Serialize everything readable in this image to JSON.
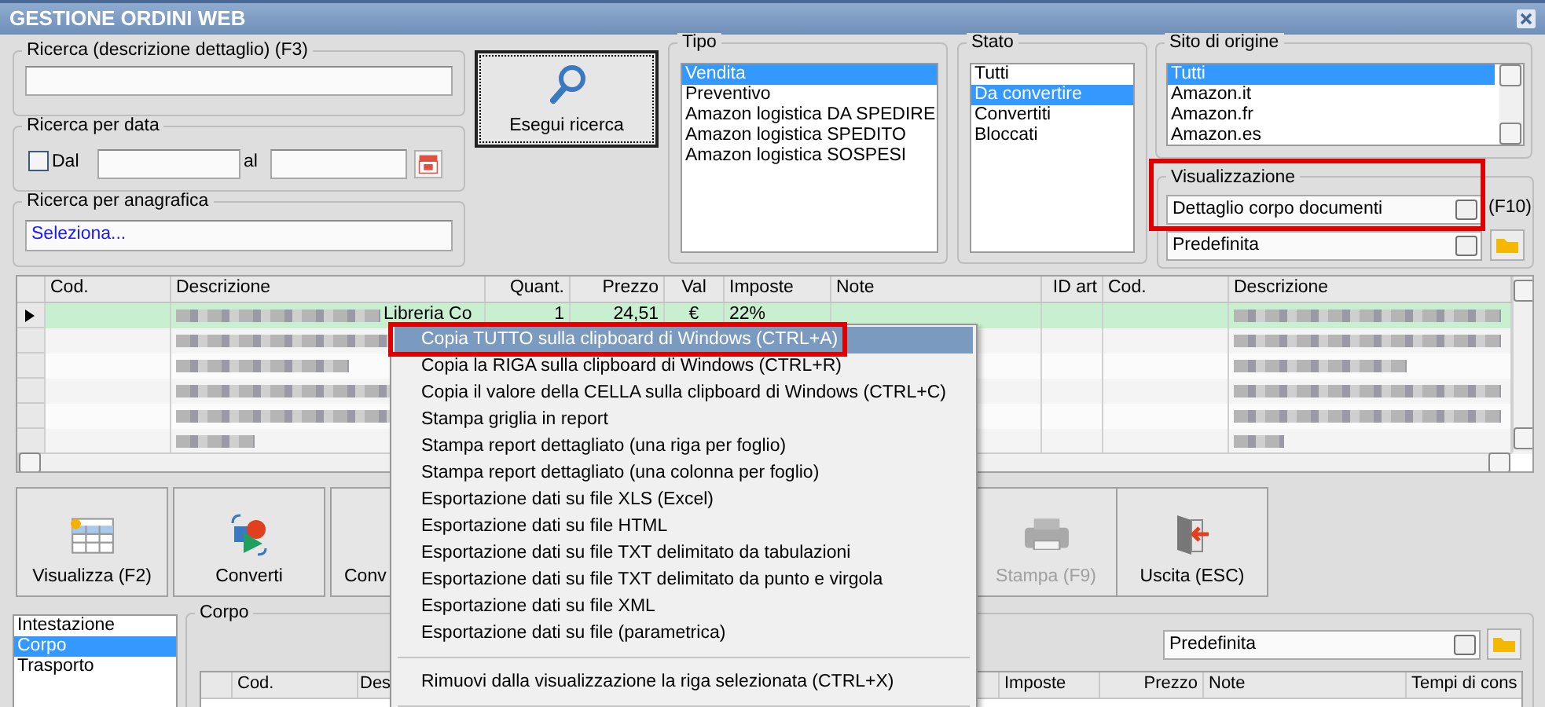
{
  "window": {
    "title": "GESTIONE ORDINI WEB"
  },
  "search_description": {
    "label": "Ricerca (descrizione dettaglio) (F3)"
  },
  "search_date": {
    "label": "Ricerca per data",
    "checkbox_label": "Dal",
    "checked": false,
    "to_label": "al"
  },
  "search_registry": {
    "label": "Ricerca per anagrafica",
    "value": "Seleziona..."
  },
  "search_button": {
    "label": "Esegui ricerca"
  },
  "tipo": {
    "label": "Tipo",
    "items": [
      {
        "label": "Vendita",
        "selected": true
      },
      {
        "label": "Preventivo",
        "selected": false
      },
      {
        "label": "Amazon logistica DA SPEDIRE",
        "selected": false
      },
      {
        "label": "Amazon logistica SPEDITO",
        "selected": false
      },
      {
        "label": "Amazon logistica SOSPESI",
        "selected": false
      }
    ]
  },
  "stato": {
    "label": "Stato",
    "items": [
      {
        "label": "Tutti",
        "selected": false
      },
      {
        "label": "Da convertire",
        "selected": true
      },
      {
        "label": "Convertiti",
        "selected": false
      },
      {
        "label": "Bloccati",
        "selected": false
      }
    ]
  },
  "sito": {
    "label": "Sito di origine",
    "items": [
      {
        "label": "Tutti",
        "selected": true
      },
      {
        "label": "Amazon.it",
        "selected": false
      },
      {
        "label": "Amazon.fr",
        "selected": false
      },
      {
        "label": "Amazon.es",
        "selected": false
      }
    ]
  },
  "visualizzazione": {
    "label": "Visualizzazione",
    "view": "Dettaglio corpo documenti",
    "shortcut": "(F10)",
    "layout": "Predefinita"
  },
  "grid": {
    "columns": [
      "Cod.",
      "Descrizione",
      "Quant.",
      "Prezzo",
      "Val",
      "Imposte",
      "Note",
      "ID art",
      "Cod.",
      "Descrizione"
    ],
    "rows": [
      {
        "selected": true,
        "redacted": true,
        "cells": [
          "",
          "Libreria Co",
          "1",
          "24,51",
          "€",
          "22%",
          "",
          "",
          "",
          ""
        ]
      },
      {
        "selected": false,
        "redacted": true,
        "cells": [
          "",
          "",
          "",
          "",
          "",
          "",
          "",
          "",
          "",
          ""
        ]
      },
      {
        "selected": false,
        "redacted": true,
        "cells": [
          "",
          "",
          "",
          "",
          "",
          "",
          "",
          "",
          "",
          ""
        ]
      },
      {
        "selected": false,
        "redacted": true,
        "cells": [
          "",
          "",
          "",
          "",
          "",
          "",
          "",
          "",
          "",
          ""
        ]
      },
      {
        "selected": false,
        "redacted": true,
        "cells": [
          "",
          "",
          "",
          "",
          "",
          "",
          "",
          "",
          "",
          ""
        ]
      },
      {
        "selected": false,
        "redacted": true,
        "cells": [
          "",
          "",
          "",
          "",
          "",
          "",
          "",
          "",
          "",
          ""
        ]
      }
    ]
  },
  "buttons": [
    {
      "label": "Visualizza (F2)",
      "disabled": false
    },
    {
      "label": "Converti",
      "disabled": false
    },
    {
      "label": "Conv",
      "disabled": false
    },
    {
      "label": "Stampa (F9)",
      "disabled": true
    },
    {
      "label": "Uscita (ESC)",
      "disabled": false
    }
  ],
  "sections": {
    "items": [
      {
        "label": "Intestazione",
        "selected": false
      },
      {
        "label": "Corpo",
        "selected": true
      },
      {
        "label": "Trasporto",
        "selected": false
      }
    ]
  },
  "corpo": {
    "label": "Corpo",
    "layout": "Predefinita",
    "columns": [
      "Cod.",
      "Des",
      "Imposte",
      "Prezzo",
      "Note",
      "Tempi di cons"
    ]
  },
  "context_menu": {
    "items": [
      {
        "kind": "item",
        "label": "Copia TUTTO sulla clipboard di Windows (CTRL+A)",
        "selected": true
      },
      {
        "kind": "item",
        "label": "Copia la RIGA sulla clipboard di Windows (CTRL+R)",
        "selected": false
      },
      {
        "kind": "item",
        "label": "Copia il valore della CELLA sulla clipboard di Windows (CTRL+C)",
        "selected": false
      },
      {
        "kind": "item",
        "label": "Stampa griglia in report",
        "selected": false
      },
      {
        "kind": "item",
        "label": "Stampa report dettagliato (una riga per foglio)",
        "selected": false
      },
      {
        "kind": "item",
        "label": "Stampa report dettagliato (una colonna per foglio)",
        "selected": false
      },
      {
        "kind": "item",
        "label": "Esportazione dati su file XLS (Excel)",
        "selected": false
      },
      {
        "kind": "item",
        "label": "Esportazione dati su file HTML",
        "selected": false
      },
      {
        "kind": "item",
        "label": "Esportazione dati su file TXT delimitato da tabulazioni",
        "selected": false
      },
      {
        "kind": "item",
        "label": "Esportazione dati su file TXT delimitato da punto e virgola",
        "selected": false
      },
      {
        "kind": "item",
        "label": "Esportazione dati su file XML",
        "selected": false
      },
      {
        "kind": "item",
        "label": "Esportazione dati su file (parametrica)",
        "selected": false
      },
      {
        "kind": "separator"
      },
      {
        "kind": "item",
        "label": "Rimuovi dalla visualizzazione la riga selezionata (CTRL+X)",
        "selected": false
      },
      {
        "kind": "separator"
      }
    ]
  }
}
